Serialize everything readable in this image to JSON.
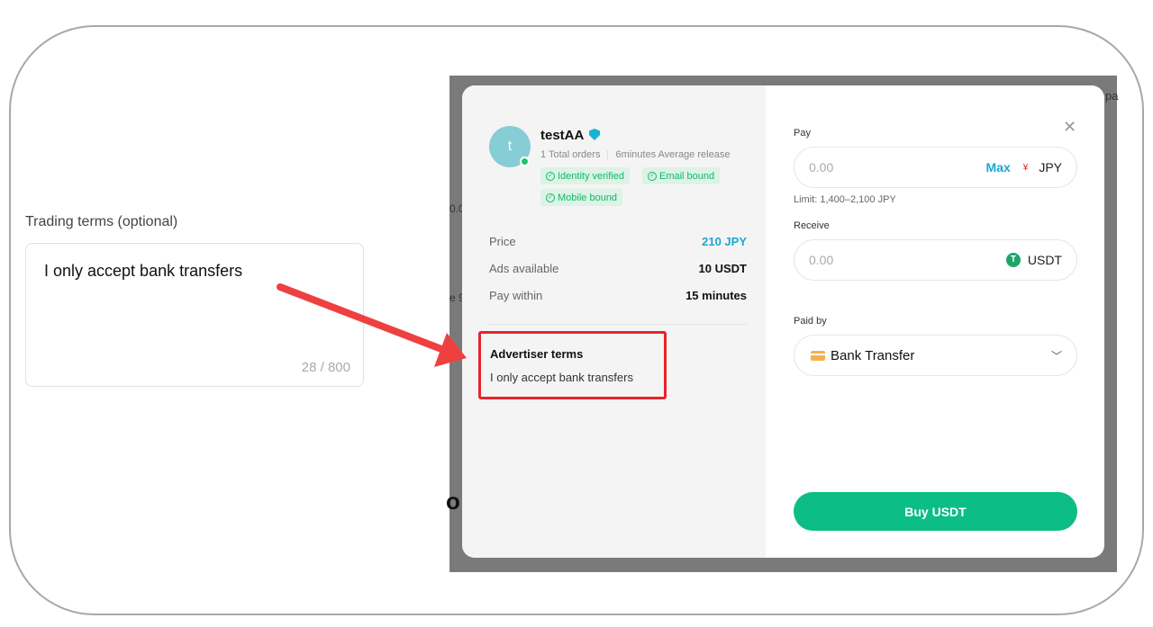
{
  "left_form": {
    "label": "Trading terms (optional)",
    "value": "I only accept bank transfers",
    "counter": "28 / 800"
  },
  "background_fragments": [
    "0.0",
    "e 9",
    "o",
    "pa"
  ],
  "advertiser": {
    "avatar_letter": "t",
    "name": "testAA",
    "total_orders": "1 Total orders",
    "avg_release": "6minutes Average release",
    "badges": [
      "Identity verified",
      "Email bound",
      "Mobile bound"
    ]
  },
  "details": [
    {
      "label": "Price",
      "value": "210 JPY"
    },
    {
      "label": "Ads available",
      "value": "10 USDT"
    },
    {
      "label": "Pay within",
      "value": "15 minutes"
    }
  ],
  "terms": {
    "title": "Advertiser terms",
    "text": "I only accept bank transfers"
  },
  "order": {
    "pay_label": "Pay",
    "pay_placeholder": "0.00",
    "max_label": "Max",
    "yen_symbol": "¥",
    "pay_currency": "JPY",
    "limit": "Limit: 1,400–2,100 JPY",
    "receive_label": "Receive",
    "receive_placeholder": "0.00",
    "receive_currency": "USDT",
    "tether_symbol": "T",
    "paid_by_label": "Paid by",
    "payment_method": "Bank Transfer",
    "buy_label": "Buy USDT",
    "close_symbol": "✕"
  },
  "colors": {
    "accent": "#19a8d1",
    "buy": "#0cbd85",
    "highlight": "#e8232b"
  }
}
